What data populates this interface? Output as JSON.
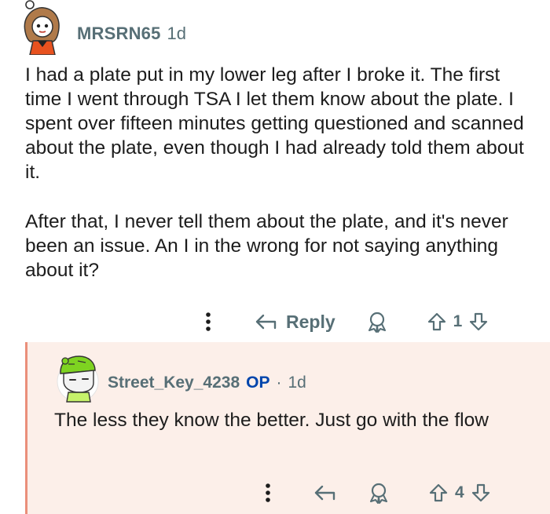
{
  "comment": {
    "username": "MRSRN65",
    "age": "1d",
    "paragraphs": [
      "I had a plate put in my lower leg after I broke it. The first time I went through TSA I let them know about the plate. I spent over fifteen minutes getting questioned and scanned about the plate, even though I had already told them about it.",
      "After that, I never tell them about the plate, and it's never been an issue. An I in the wrong for not saying anything about it?"
    ],
    "actions": {
      "reply_label": "Reply",
      "score": "1"
    }
  },
  "reply": {
    "username": "Street_Key_4238",
    "op_badge": "OP",
    "separator": "·",
    "age": "1d",
    "text": "The less they know the better. Just go with the flow",
    "actions": {
      "score": "4"
    }
  },
  "colors": {
    "meta": "#576f76",
    "op": "#0045ac",
    "reply_bg": "#fcefe9",
    "thread_line": "#ea8f7a"
  },
  "icons": [
    "more-vertical-icon",
    "reply-arrow-icon",
    "award-icon",
    "upvote-icon",
    "downvote-icon"
  ]
}
